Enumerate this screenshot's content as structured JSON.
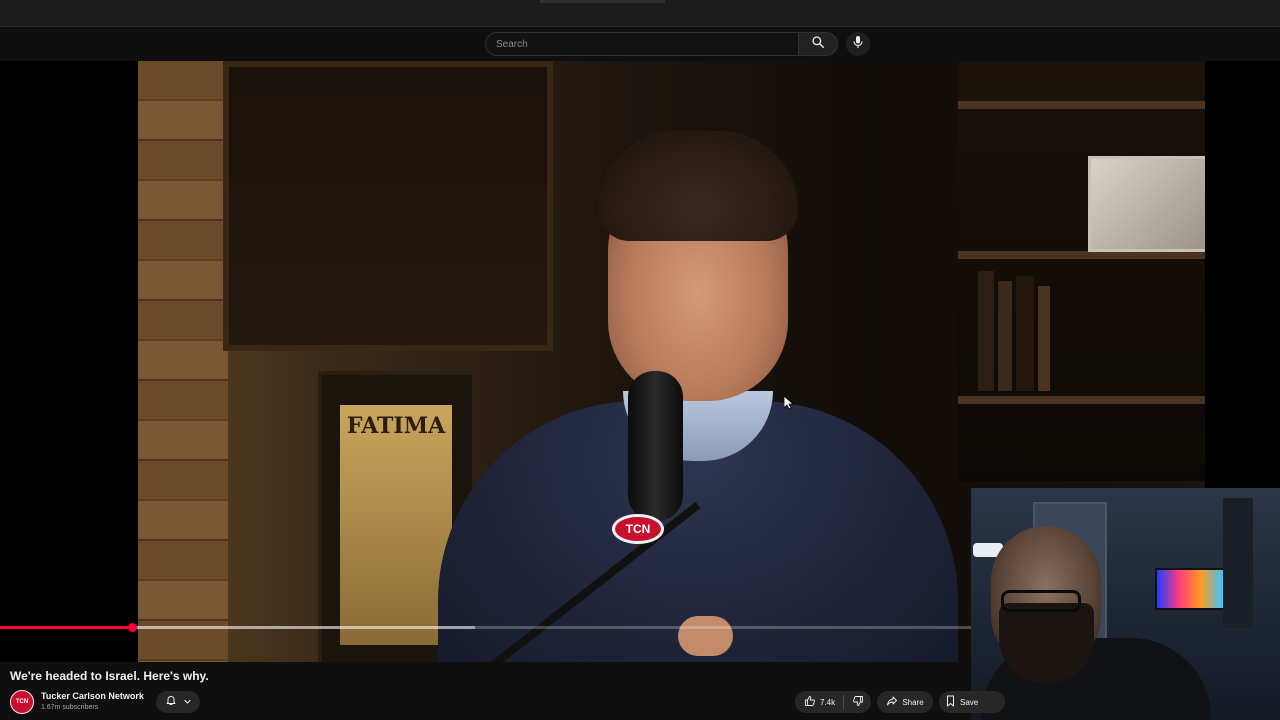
{
  "search": {
    "placeholder": "Search",
    "value": ""
  },
  "video": {
    "title": "We're headed to Israel. Here's why.",
    "progress": {
      "played_fraction": 0.136,
      "buffered_fraction": 0.489
    },
    "on_screen_text": {
      "poster_word": "FATIMA",
      "mic_badge": "TCN"
    }
  },
  "channel": {
    "avatar_text": "TCN",
    "name": "Tucker Carlson Network",
    "subscribers": "1.67m subscribers"
  },
  "actions": {
    "like_count": "7.4k",
    "share_label": "Share",
    "save_label": "Save"
  },
  "icons": {
    "search": "search-icon",
    "mic": "mic-icon",
    "bell": "bell-icon",
    "chevron": "chevron-down-icon",
    "like": "thumbs-up-icon",
    "dislike": "thumbs-down-icon",
    "share": "share-icon",
    "save": "bookmark-icon"
  },
  "colors": {
    "background": "#0f0f0f",
    "progress_played": "#ff0033",
    "pill_background": "#272727",
    "brand_red": "#c8102e"
  }
}
